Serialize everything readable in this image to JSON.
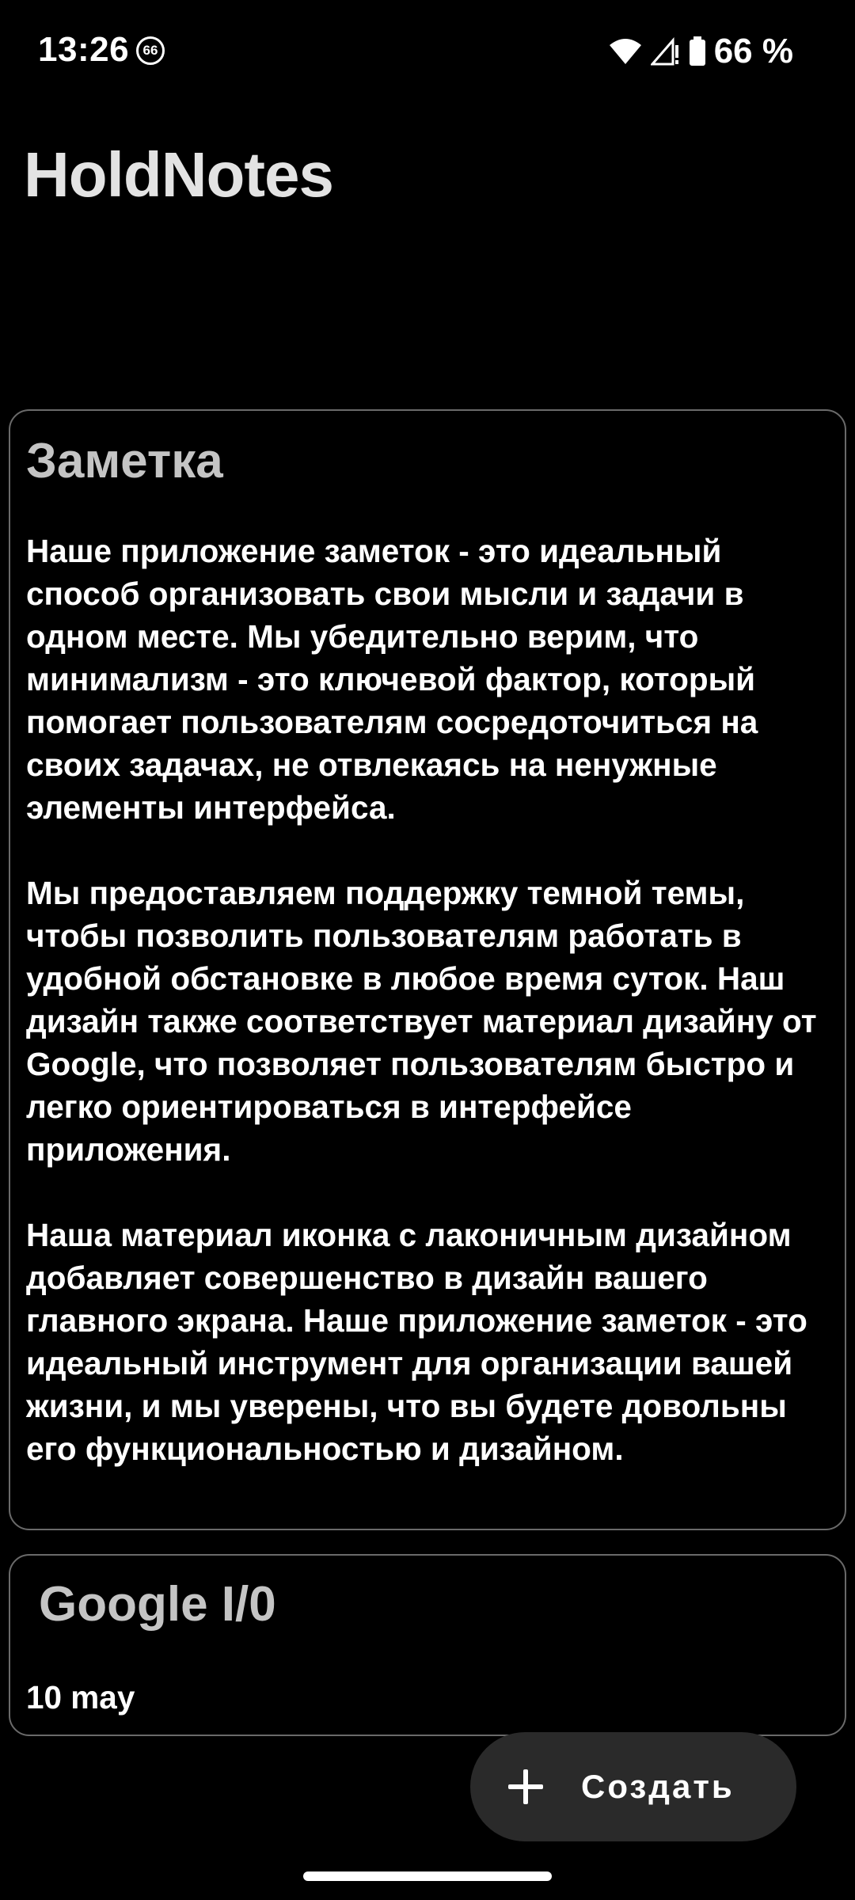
{
  "status_bar": {
    "time": "13:26",
    "notification_badge": "66",
    "battery_text": "66 %",
    "icons": [
      "wifi-icon",
      "cell-signal-icon",
      "battery-icon"
    ]
  },
  "app": {
    "title": "HoldNotes"
  },
  "notes": [
    {
      "title": "Заметка",
      "body": "Наше приложение заметок - это идеальный способ организовать свои мысли и задачи в одном месте. Мы убедительно верим, что минимализм - это ключевой фактор, который помогает пользователям сосредоточиться на своих задачах, не отвлекаясь на ненужные элементы интерфейса.\n\nМы предоставляем поддержку темной темы, чтобы позволить пользователям работать в удобной обстановке в любое время суток. Наш дизайн также соответствует материал дизайну от Google, что позволяет пользователям быстро и легко ориентироваться в интерфейсе приложения.\n\nНаша материал иконка с лаконичным дизайном добавляет совершенство в дизайн вашего главного экрана. Наше приложение заметок - это идеальный инструмент для организации вашей жизни, и мы уверены, что вы будете довольны его функциональностью и дизайном."
    },
    {
      "title": "Google I/0",
      "body": "10 may"
    }
  ],
  "fab": {
    "label": "Создать",
    "icon": "plus-icon"
  },
  "colors": {
    "background": "#000000",
    "card_border": "#6a6a6a",
    "title": "#e3e3e3",
    "note_title": "#c4c4c4",
    "fab_background": "#2a2a2a"
  }
}
